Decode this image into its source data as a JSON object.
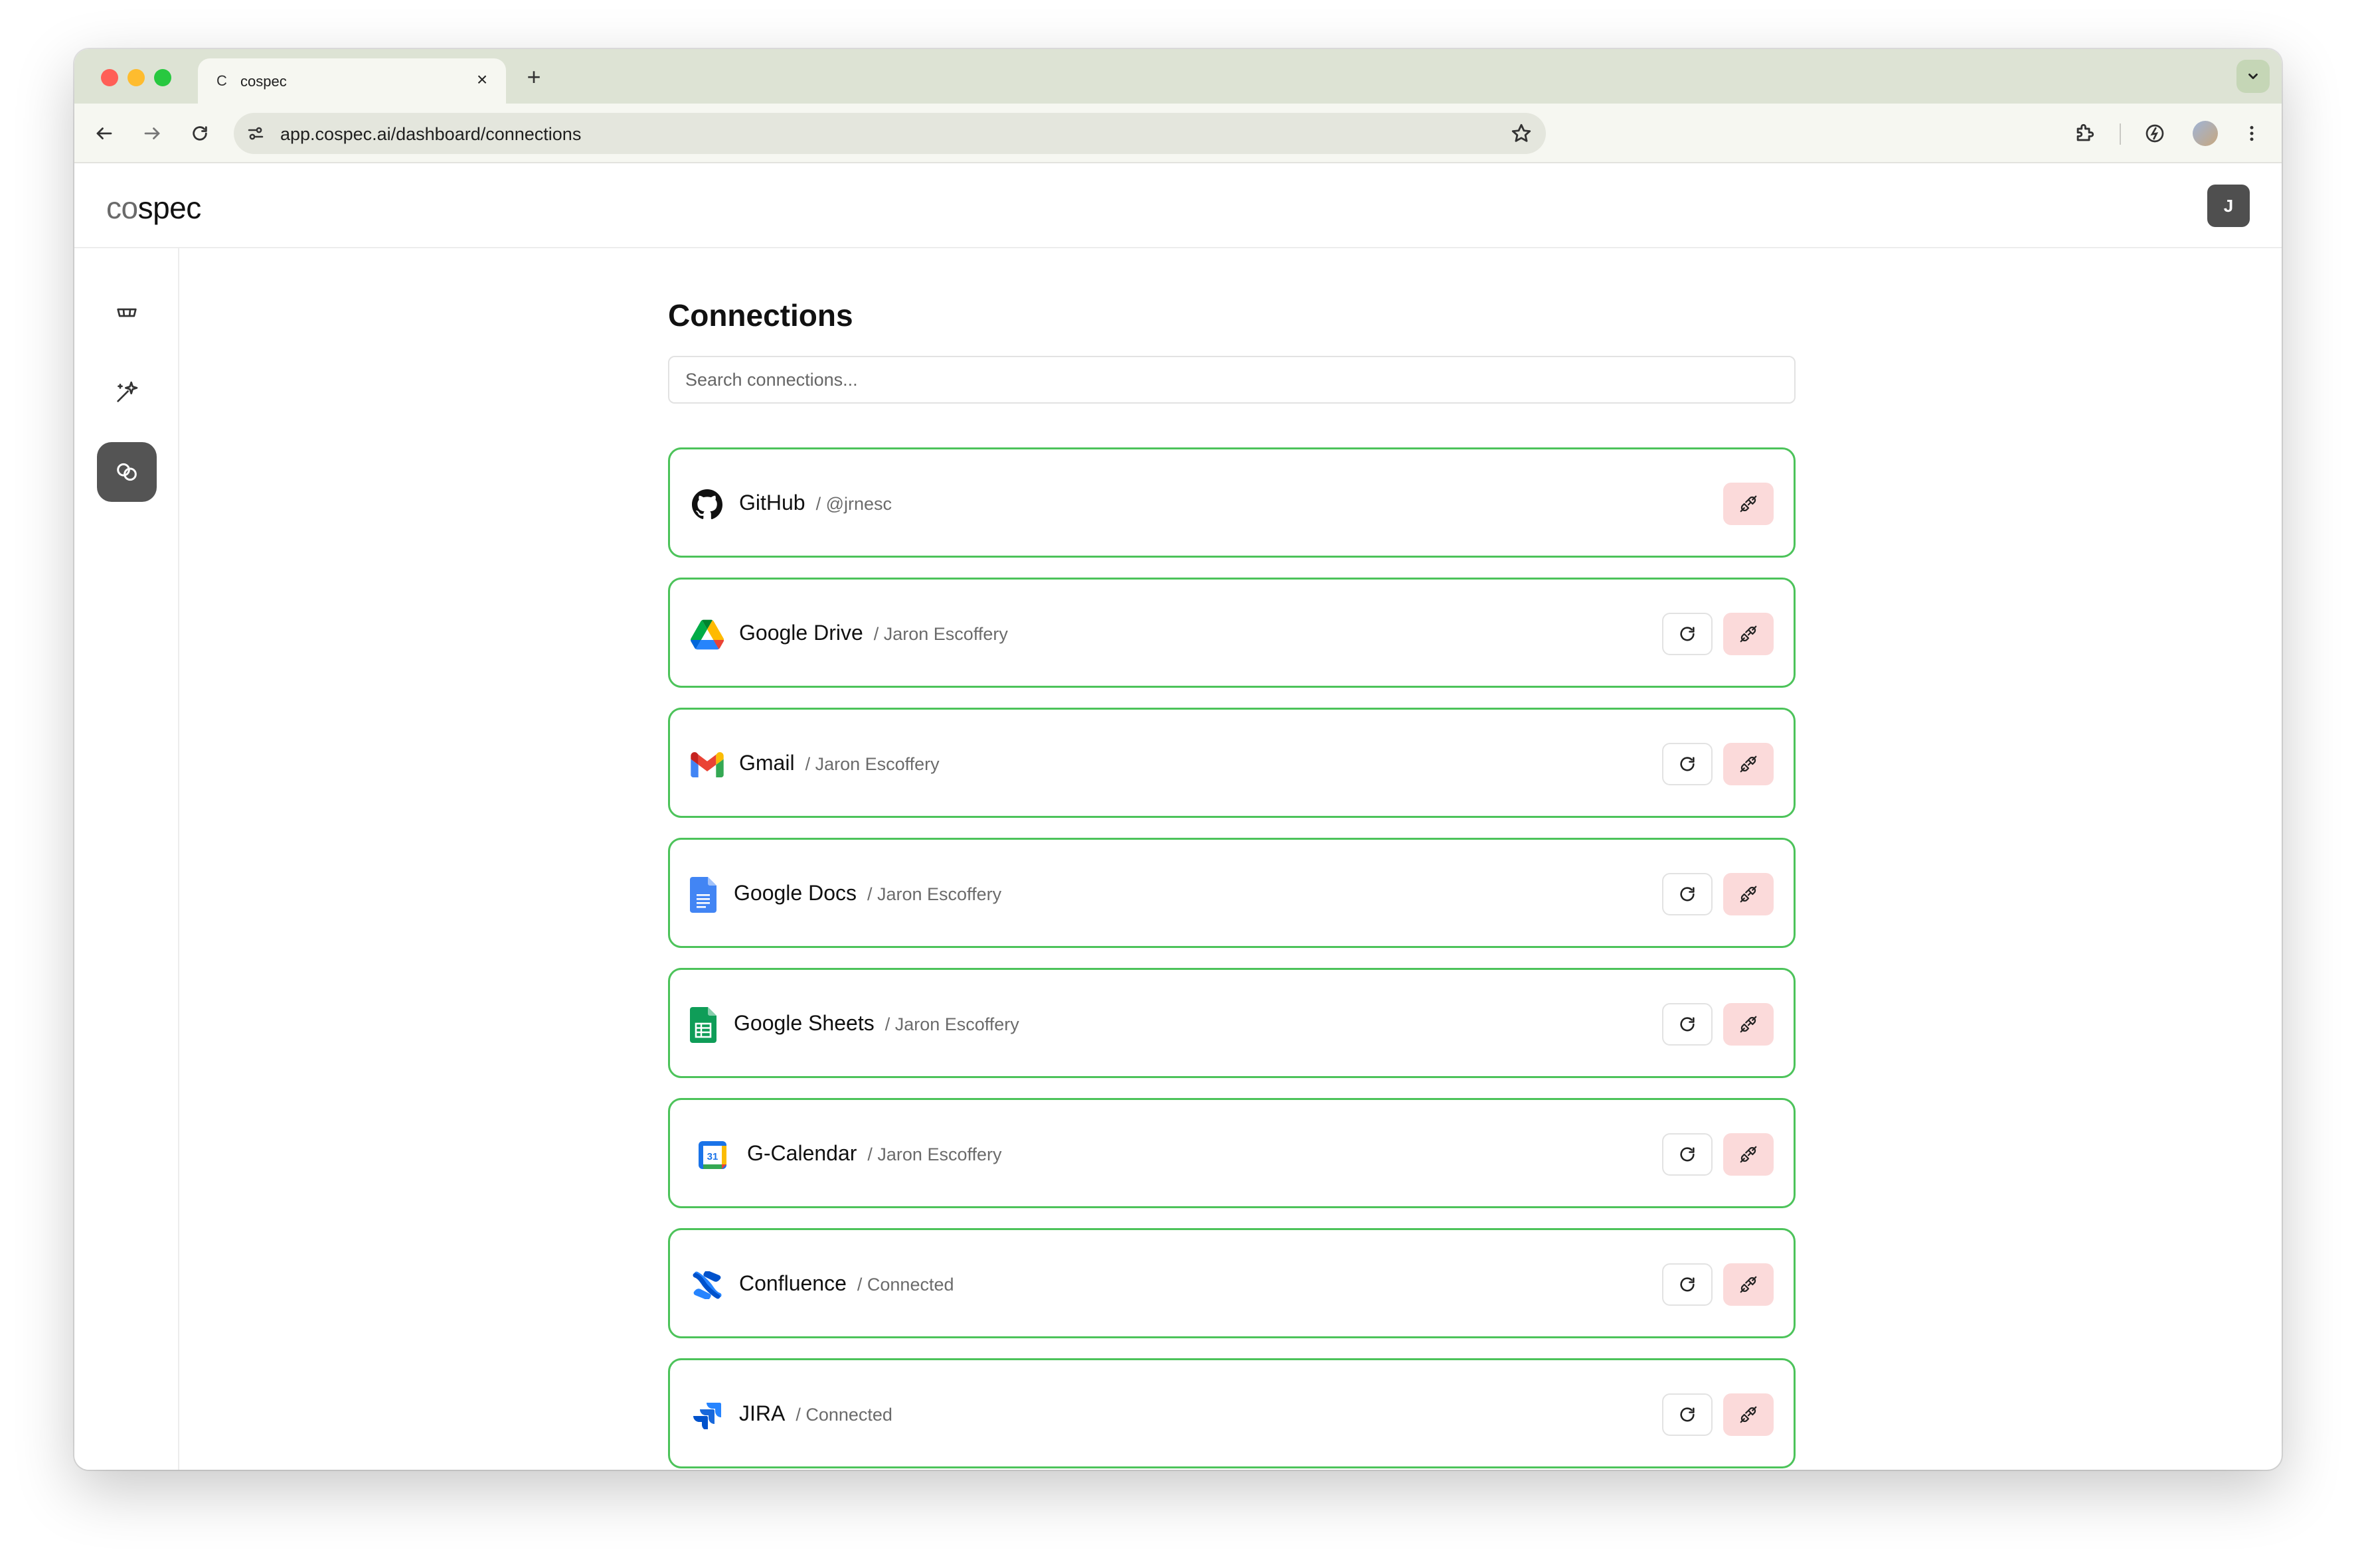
{
  "browser": {
    "tab_title": "cospec",
    "tab_favicon": "C",
    "url": "app.cospec.ai/dashboard/connections",
    "new_tab_glyph": "+",
    "close_glyph": "×"
  },
  "app": {
    "logo_co": "co",
    "logo_spec": "spec",
    "user_initial": "J"
  },
  "sidebar": {
    "items": [
      {
        "icon": "box-icon",
        "active": false
      },
      {
        "icon": "sparkle-icon",
        "active": false
      },
      {
        "icon": "link-icon",
        "active": true
      }
    ]
  },
  "page": {
    "title": "Connections",
    "search_placeholder": "Search connections..."
  },
  "connections": [
    {
      "name": "GitHub",
      "detail": "/ @jrnesc",
      "icon": "github-icon",
      "refresh": false
    },
    {
      "name": "Google Drive",
      "detail": "/ Jaron Escoffery",
      "icon": "google-drive-icon",
      "refresh": true
    },
    {
      "name": "Gmail",
      "detail": "/ Jaron Escoffery",
      "icon": "gmail-icon",
      "refresh": true
    },
    {
      "name": "Google Docs",
      "detail": "/ Jaron Escoffery",
      "icon": "google-docs-icon",
      "refresh": true
    },
    {
      "name": "Google Sheets",
      "detail": "/ Jaron Escoffery",
      "icon": "google-sheets-icon",
      "refresh": true
    },
    {
      "name": "G-Calendar",
      "detail": "/ Jaron Escoffery",
      "icon": "google-calendar-icon",
      "refresh": true,
      "calendar_day": "31"
    },
    {
      "name": "Confluence",
      "detail": "/ Connected",
      "icon": "confluence-icon",
      "refresh": true
    },
    {
      "name": "JIRA",
      "detail": "/ Connected",
      "icon": "jira-icon",
      "refresh": true
    }
  ],
  "colors": {
    "card_border": "#4cc35a",
    "disconnect_bg": "#fbdada",
    "sidebar_active": "#545454",
    "tabstrip": "#dde3d4"
  }
}
